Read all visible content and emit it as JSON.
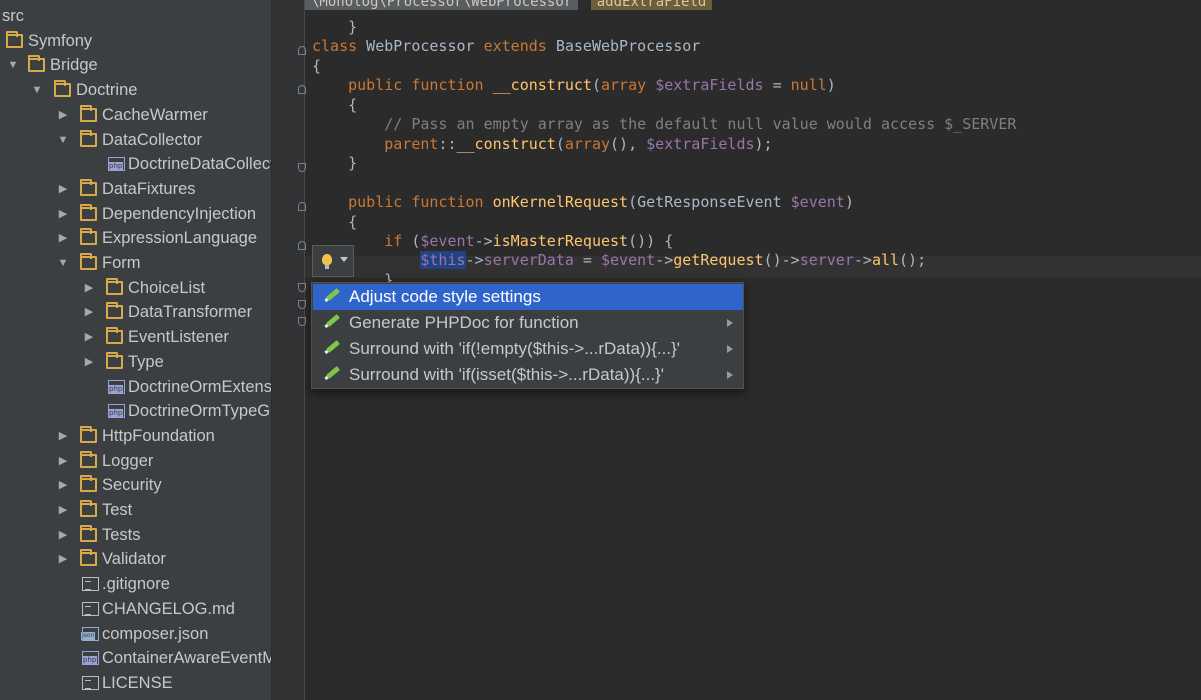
{
  "tree": {
    "items": [
      {
        "label": "src",
        "depth": 0,
        "type": "root"
      },
      {
        "label": "Symfony",
        "depth": 0,
        "type": "folder",
        "arrow": ""
      },
      {
        "label": "Bridge",
        "depth": 0,
        "type": "folder",
        "arrow": "▼"
      },
      {
        "label": "Doctrine",
        "depth": 1,
        "type": "folder",
        "arrow": "▼"
      },
      {
        "label": "CacheWarmer",
        "depth": 2,
        "type": "folder",
        "arrow": "▶"
      },
      {
        "label": "DataCollector",
        "depth": 2,
        "type": "folder",
        "arrow": "▼"
      },
      {
        "label": "DoctrineDataCollector.php",
        "depth": 3,
        "type": "php"
      },
      {
        "label": "DataFixtures",
        "depth": 2,
        "type": "folder",
        "arrow": "▶"
      },
      {
        "label": "DependencyInjection",
        "depth": 2,
        "type": "folder",
        "arrow": "▶"
      },
      {
        "label": "ExpressionLanguage",
        "depth": 2,
        "type": "folder",
        "arrow": "▶"
      },
      {
        "label": "Form",
        "depth": 2,
        "type": "folder",
        "arrow": "▼"
      },
      {
        "label": "ChoiceList",
        "depth": 3,
        "type": "folder",
        "arrow": "▶"
      },
      {
        "label": "DataTransformer",
        "depth": 3,
        "type": "folder",
        "arrow": "▶"
      },
      {
        "label": "EventListener",
        "depth": 3,
        "type": "folder",
        "arrow": "▶"
      },
      {
        "label": "Type",
        "depth": 3,
        "type": "folder",
        "arrow": "▶"
      },
      {
        "label": "DoctrineOrmExtension.php",
        "depth": 3,
        "type": "php"
      },
      {
        "label": "DoctrineOrmTypeGuesser.php",
        "depth": 3,
        "type": "php"
      },
      {
        "label": "HttpFoundation",
        "depth": 2,
        "type": "folder",
        "arrow": "▶"
      },
      {
        "label": "Logger",
        "depth": 2,
        "type": "folder",
        "arrow": "▶"
      },
      {
        "label": "Security",
        "depth": 2,
        "type": "folder",
        "arrow": "▶"
      },
      {
        "label": "Test",
        "depth": 2,
        "type": "folder",
        "arrow": "▶"
      },
      {
        "label": "Tests",
        "depth": 2,
        "type": "folder",
        "arrow": "▶"
      },
      {
        "label": "Validator",
        "depth": 2,
        "type": "folder",
        "arrow": "▶"
      },
      {
        "label": ".gitignore",
        "depth": 2,
        "type": "txt"
      },
      {
        "label": "CHANGELOG.md",
        "depth": 2,
        "type": "txt"
      },
      {
        "label": "composer.json",
        "depth": 2,
        "type": "json"
      },
      {
        "label": "ContainerAwareEventManager.php",
        "depth": 2,
        "type": "php"
      },
      {
        "label": "LICENSE",
        "depth": 2,
        "type": "txt"
      }
    ]
  },
  "breadcrumbs": [
    "\\Monolog\\Processor\\WebProcessor",
    "addExtraField"
  ],
  "code": {
    "lines": [
      [
        {
          "t": "    }"
        }
      ],
      [
        {
          "t": "class",
          "c": "kw"
        },
        {
          "t": " WebProcessor "
        },
        {
          "t": "extends",
          "c": "kw"
        },
        {
          "t": " BaseWebProcessor"
        }
      ],
      [
        {
          "t": "{"
        }
      ],
      [
        {
          "t": "    "
        },
        {
          "t": "public function",
          "c": "kw"
        },
        {
          "t": " "
        },
        {
          "t": "__construct",
          "c": "fn"
        },
        {
          "t": "("
        },
        {
          "t": "array",
          "c": "kw"
        },
        {
          "t": " "
        },
        {
          "t": "$extraFields",
          "c": "var"
        },
        {
          "t": " = "
        },
        {
          "t": "null",
          "c": "kw"
        },
        {
          "t": ")"
        }
      ],
      [
        {
          "t": "    {"
        }
      ],
      [
        {
          "t": "        "
        },
        {
          "t": "// Pass an empty array as the default null value would access $_SERVER",
          "c": "cm"
        }
      ],
      [
        {
          "t": "        "
        },
        {
          "t": "parent",
          "c": "kw"
        },
        {
          "t": "::"
        },
        {
          "t": "__construct",
          "c": "fn"
        },
        {
          "t": "("
        },
        {
          "t": "array",
          "c": "kw"
        },
        {
          "t": "(), "
        },
        {
          "t": "$extraFields",
          "c": "var"
        },
        {
          "t": ");"
        }
      ],
      [
        {
          "t": "    }"
        }
      ],
      [
        {
          "t": ""
        }
      ],
      [
        {
          "t": "    "
        },
        {
          "t": "public function",
          "c": "kw"
        },
        {
          "t": " "
        },
        {
          "t": "onKernelRequest",
          "c": "fn"
        },
        {
          "t": "(GetResponseEvent "
        },
        {
          "t": "$event",
          "c": "var"
        },
        {
          "t": ")"
        }
      ],
      [
        {
          "t": "    {"
        }
      ],
      [
        {
          "t": "        "
        },
        {
          "t": "if",
          "c": "kw"
        },
        {
          "t": " ("
        },
        {
          "t": "$event",
          "c": "var"
        },
        {
          "t": "->"
        },
        {
          "t": "isMasterRequest",
          "c": "fn"
        },
        {
          "t": "()) {"
        }
      ],
      [
        {
          "t": "            "
        },
        {
          "t": "$this",
          "c": "var sel"
        },
        {
          "t": "->"
        },
        {
          "t": "serverData",
          "c": "var"
        },
        {
          "t": " = "
        },
        {
          "t": "$event",
          "c": "var"
        },
        {
          "t": "->"
        },
        {
          "t": "getRequest",
          "c": "fn"
        },
        {
          "t": "()->"
        },
        {
          "t": "server",
          "c": "var"
        },
        {
          "t": "->"
        },
        {
          "t": "all",
          "c": "fn"
        },
        {
          "t": "();"
        }
      ],
      [
        {
          "t": "        }"
        }
      ]
    ]
  },
  "intentions": {
    "bulb_icon": "lightbulb-icon",
    "items": [
      {
        "label": "Adjust code style settings",
        "active": true,
        "submenu": false
      },
      {
        "label": "Generate PHPDoc for function",
        "active": false,
        "submenu": true
      },
      {
        "label": "Surround with 'if(!empty($this->...rData)){...}'",
        "active": false,
        "submenu": true
      },
      {
        "label": "Surround with 'if(isset($this->...rData)){...}'",
        "active": false,
        "submenu": true
      }
    ]
  }
}
